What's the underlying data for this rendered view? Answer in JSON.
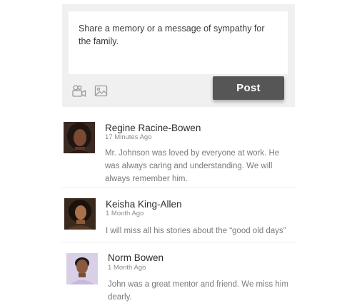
{
  "composer": {
    "placeholder": "Share a memory or a message of sympathy for the family.",
    "post_label": "Post",
    "video_icon": "video-camera-icon",
    "image_icon": "image-icon"
  },
  "comments": [
    {
      "author": "Regine Racine-Bowen",
      "time": "17 Minutes Ago",
      "text": "Mr. Johnson was loved by everyone at work. He was always caring and understanding. We will always remember him."
    },
    {
      "author": "Keisha King-Allen",
      "time": "1 Month Ago",
      "text": "I will miss all his stories about the “good old days”"
    },
    {
      "author": "Norm Bowen",
      "time": "1 Month Ago",
      "text": "John was a great mentor and friend. We miss him dearly."
    }
  ],
  "colors": {
    "post_button": "#565656",
    "composer_bg": "#f0f0f0"
  }
}
